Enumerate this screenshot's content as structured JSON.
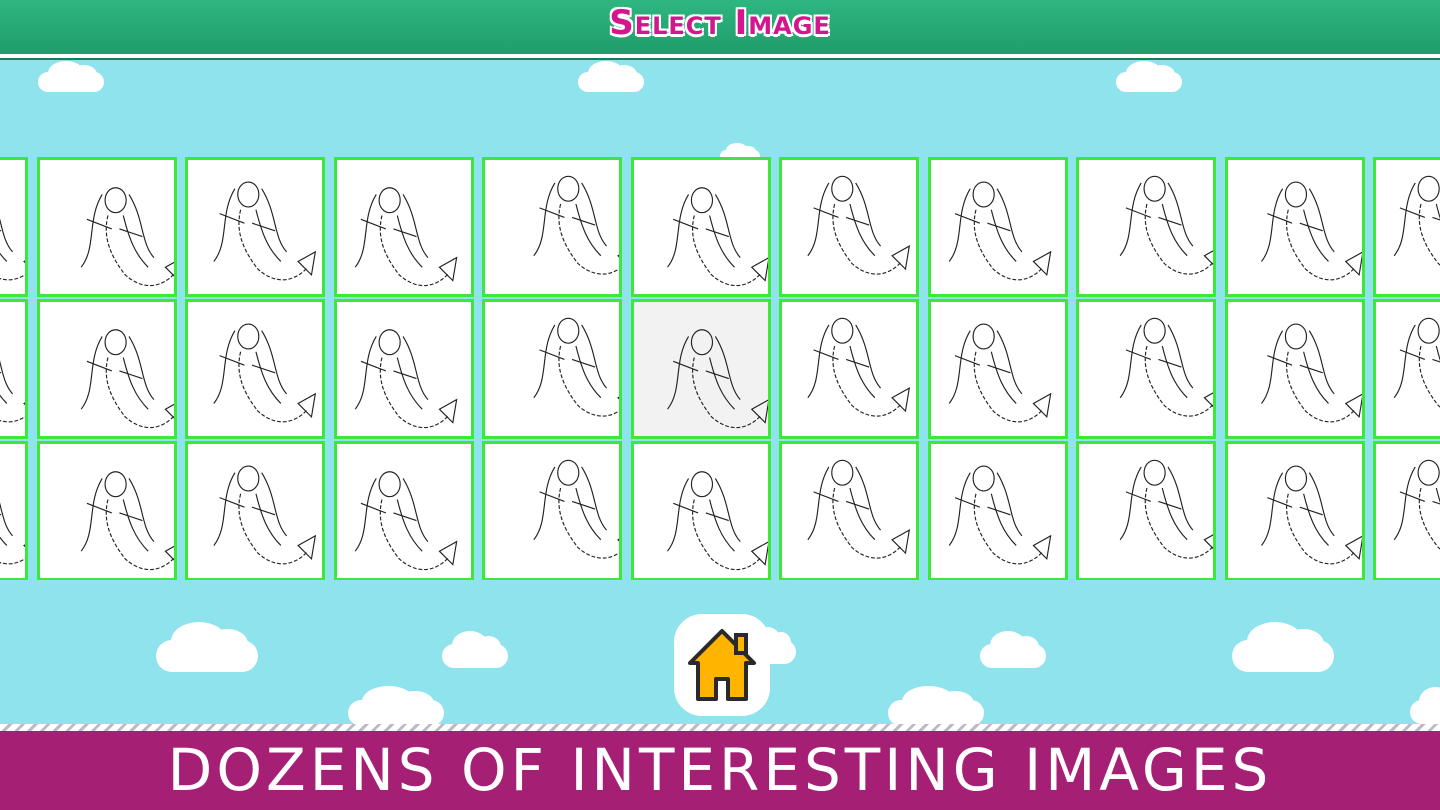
{
  "header": {
    "title": "Select Image"
  },
  "clouds": [
    {
      "name": "cloud"
    },
    {
      "name": "cloud"
    },
    {
      "name": "cloud"
    },
    {
      "name": "cloud"
    },
    {
      "name": "cloud"
    },
    {
      "name": "cloud"
    },
    {
      "name": "cloud"
    },
    {
      "name": "cloud"
    },
    {
      "name": "cloud"
    },
    {
      "name": "cloud"
    },
    {
      "name": "cloud"
    },
    {
      "name": "cloud"
    }
  ],
  "grid": {
    "rows": 3,
    "columns": 11,
    "selected": {
      "row": 2,
      "column": 5
    },
    "tile_border_color": "#3ee83a",
    "image_subject": "mermaid coloring page"
  },
  "home_button": {
    "icon": "home-icon",
    "color": "#ffb400"
  },
  "banner": {
    "text": "DOZENS OF INTERESTING IMAGES",
    "color": "#a51f75"
  },
  "colors": {
    "sky": "#8fe3ec",
    "header": "#1f9d6b",
    "title": "#d4168e"
  }
}
